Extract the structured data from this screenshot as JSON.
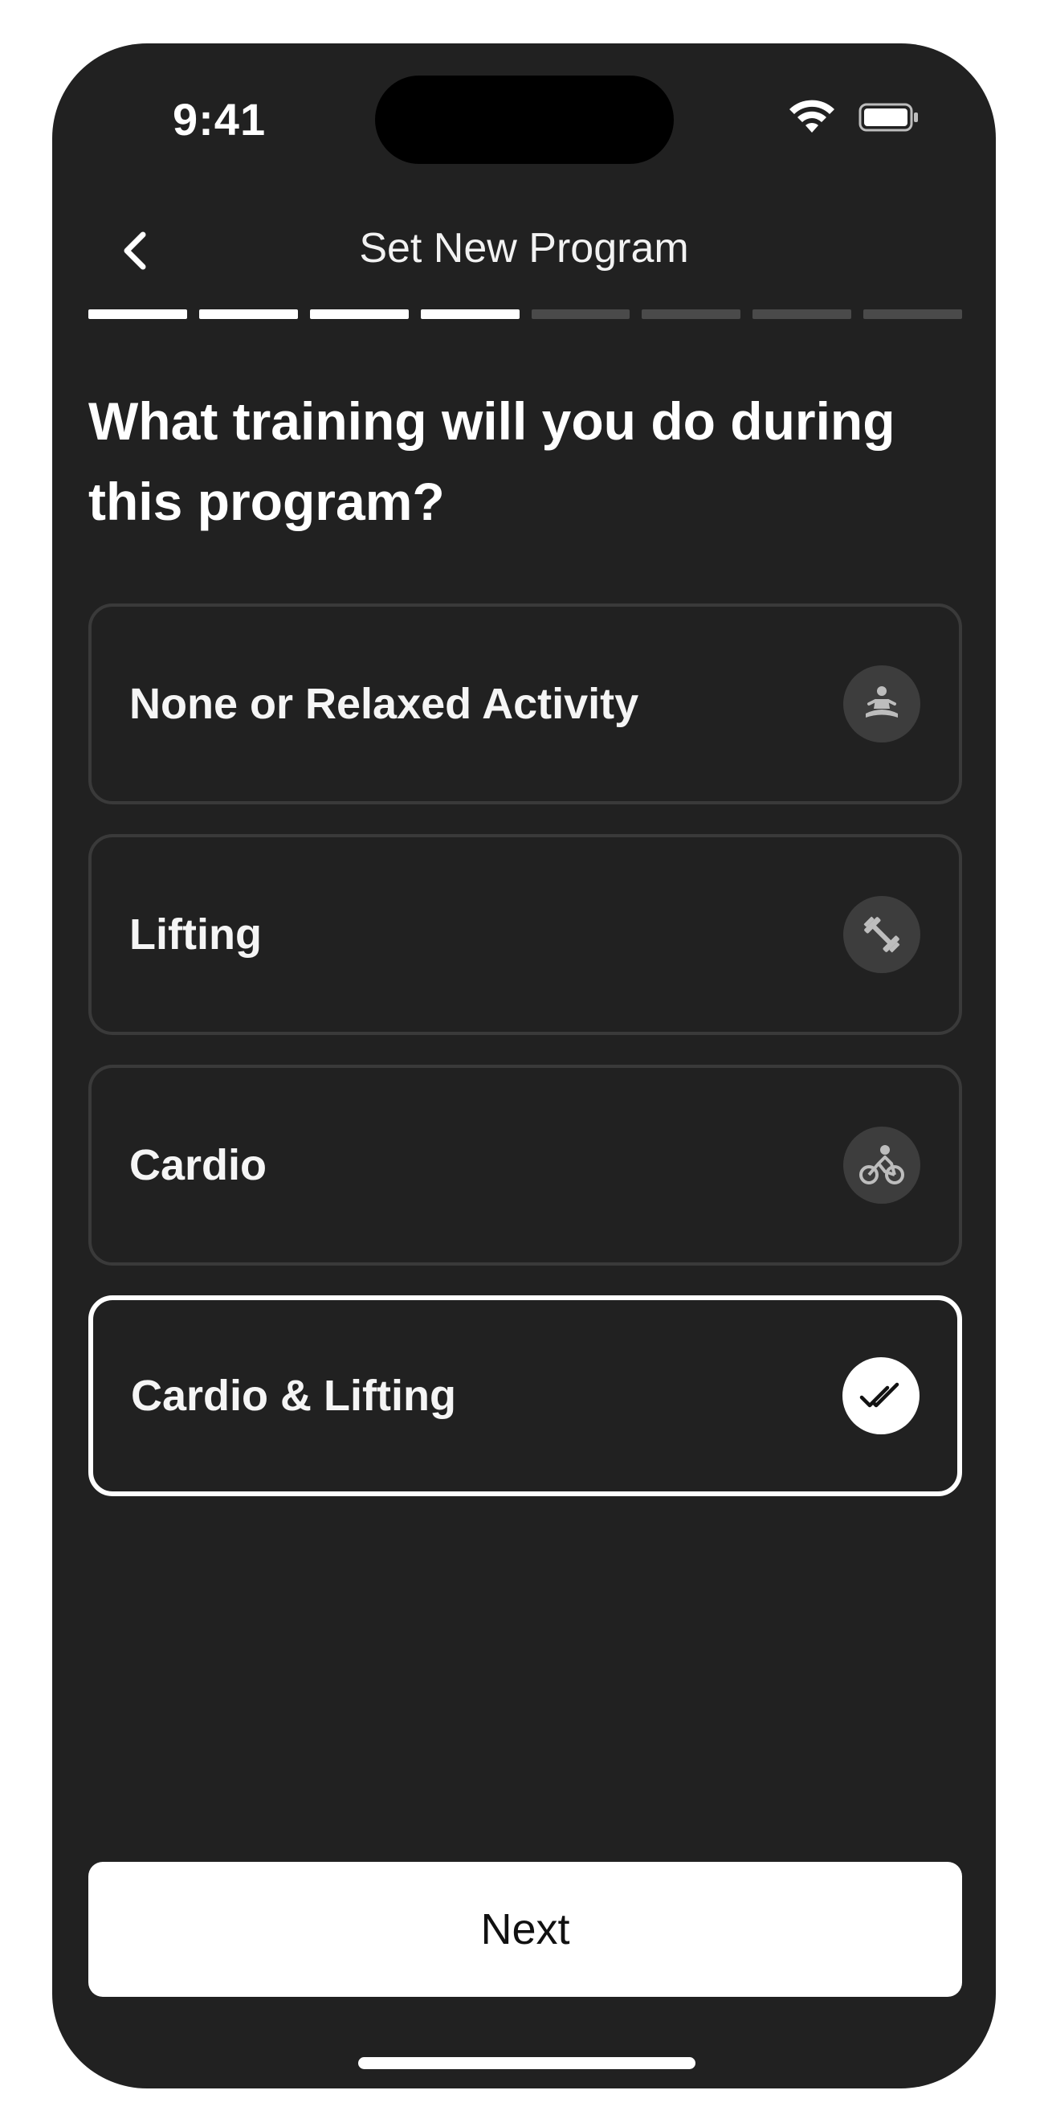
{
  "status_bar": {
    "time": "9:41"
  },
  "header": {
    "title": "Set New Program",
    "back_icon": "chevron-left-icon"
  },
  "progress": {
    "total_steps": 8,
    "completed_steps": 4
  },
  "question": "What training will you do during this program?",
  "options": [
    {
      "label": "None or Relaxed Activity",
      "icon": "meditation-icon",
      "selected": false
    },
    {
      "label": "Lifting",
      "icon": "dumbbell-icon",
      "selected": false
    },
    {
      "label": "Cardio",
      "icon": "cycling-icon",
      "selected": false
    },
    {
      "label": "Cardio & Lifting",
      "icon": "double-check-icon",
      "selected": true
    }
  ],
  "next_button": {
    "label": "Next"
  },
  "colors": {
    "background": "#212121",
    "accent": "#ffffff",
    "card_border": "#3a3a3a",
    "progress_inactive": "#4a4a4a"
  }
}
